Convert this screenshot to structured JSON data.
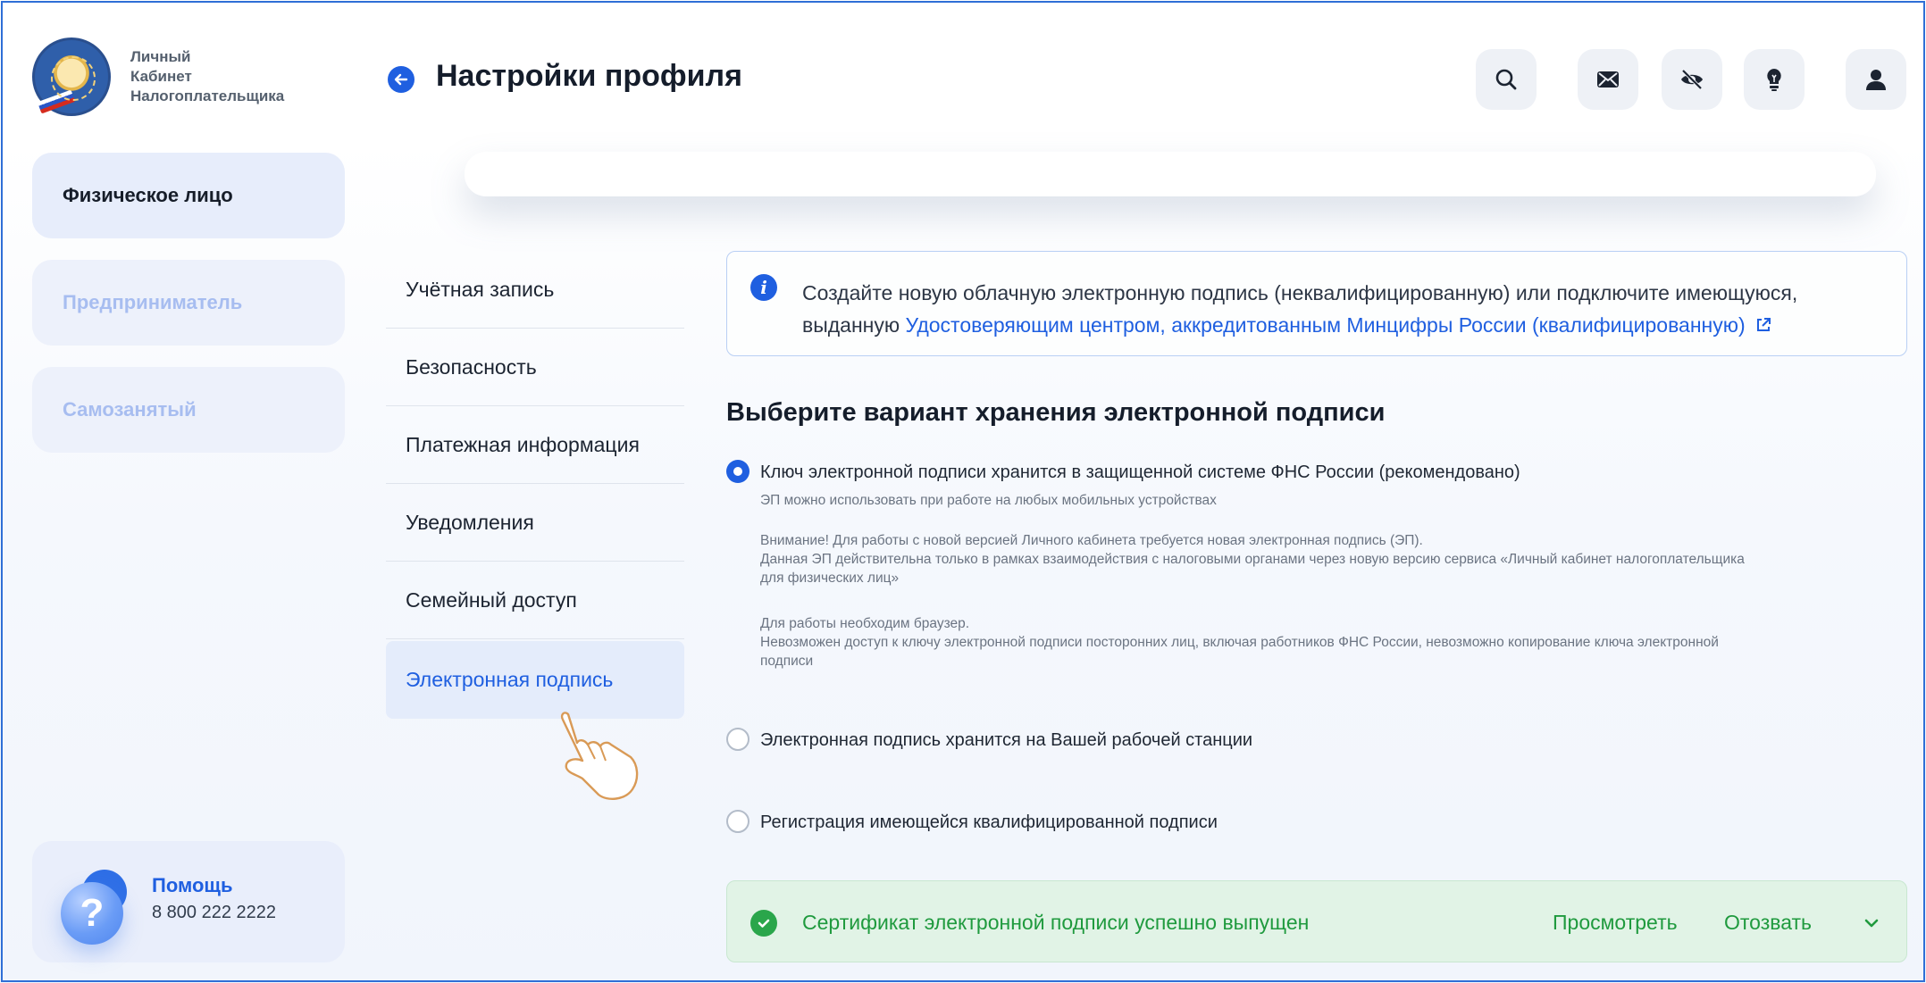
{
  "app": {
    "logo_text": [
      "Личный",
      "Кабинет",
      "Налогоплательщика"
    ],
    "logo_icon": "fns-emblem-icon"
  },
  "header": {
    "back_icon": "arrow-left-icon",
    "title": "Настройки профиля",
    "buttons": [
      "search-icon",
      "mail-icon",
      "eye-off-icon",
      "lightbulb-icon",
      "user-icon"
    ]
  },
  "sidebar": {
    "items": [
      {
        "label": "Физическое лицо",
        "active": true
      },
      {
        "label": "Предприниматель",
        "active": false
      },
      {
        "label": "Самозанятый",
        "active": false
      }
    ],
    "help": {
      "title": "Помощь",
      "phone": "8 800 222 2222",
      "icon": "question-icon"
    }
  },
  "settings_menu": {
    "items": [
      {
        "label": "Учётная запись"
      },
      {
        "label": "Безопасность"
      },
      {
        "label": "Платежная информация"
      },
      {
        "label": "Уведомления"
      },
      {
        "label": "Семейный доступ"
      },
      {
        "label": "Электронная подпись",
        "active": true
      }
    ]
  },
  "info": {
    "text_part1": "Создайте новую облачную электронную подпись (неквалифицированную) или подключите имеющуюся, выданную ",
    "link": "Удостоверяющим центром, аккредитованным Минцифры России (квалифицированную)",
    "link_icon": "external-link-icon"
  },
  "section": {
    "title": "Выберите вариант хранения электронной подписи",
    "options": [
      {
        "label": "Ключ электронной подписи хранится в защищенной системе ФНС России (рекомендовано)",
        "checked": true,
        "hint": "ЭП можно использовать при работе на любых мобильных устройствах",
        "warning_lines": [
          "Внимание! Для работы с новой версией Личного кабинета требуется новая электронная подпись (ЭП).",
          "Данная ЭП действительна только в рамках взаимодействия с налоговыми органами через новую версию сервиса «Личный кабинет налогоплательщика",
          "для физических лиц»"
        ],
        "note_lines": [
          "Для работы необходим браузер.",
          "Невозможен доступ к ключу электронной подписи посторонних лиц, включая работников ФНС России, невозможно копирование ключа электронной",
          "подписи"
        ]
      },
      {
        "label": "Электронная подпись хранится на Вашей рабочей станции",
        "checked": false
      },
      {
        "label": "Регистрация имеющейся квалифицированной подписи",
        "checked": false
      }
    ]
  },
  "certificate": {
    "status": "Сертификат электронной подписи успешно выпущен",
    "view_label": "Просмотреть",
    "revoke_label": "Отозвать",
    "icon": "check-circle-icon",
    "expand_icon": "chevron-down-icon"
  },
  "colors": {
    "accent": "#1f5fe0",
    "success": "#1f9a3e",
    "success_bg": "#e1f3e6"
  }
}
